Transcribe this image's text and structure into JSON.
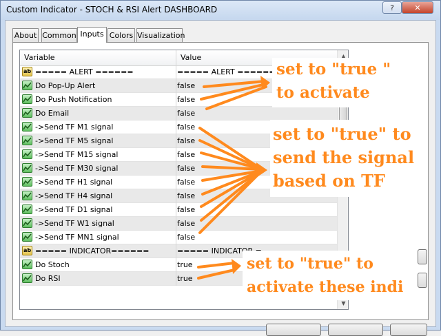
{
  "window": {
    "title": "Custom Indicator - STOCH & RSI Alert DASHBOARD",
    "help_label": "?",
    "close_label": "✕"
  },
  "tabs": [
    {
      "label": "About",
      "active": false
    },
    {
      "label": "Common",
      "active": false
    },
    {
      "label": "Inputs",
      "active": true
    },
    {
      "label": "Colors",
      "active": false
    },
    {
      "label": "Visualization",
      "active": false
    }
  ],
  "grid": {
    "columns": {
      "variable": "Variable",
      "value": "Value"
    },
    "rows": [
      {
        "icon": "ab-icon",
        "variable": "===== ALERT ======",
        "value": "===== ALERT ======"
      },
      {
        "icon": "chart-icon",
        "variable": "Do Pop-Up Alert",
        "value": "false"
      },
      {
        "icon": "chart-icon",
        "variable": "Do Push Notification",
        "value": "false"
      },
      {
        "icon": "chart-icon",
        "variable": "Do Email",
        "value": "false"
      },
      {
        "icon": "chart-icon",
        "variable": "->Send TF M1 signal",
        "value": "false"
      },
      {
        "icon": "chart-icon",
        "variable": "->Send TF M5 signal",
        "value": "false"
      },
      {
        "icon": "chart-icon",
        "variable": "->Send TF M15 signal",
        "value": "false"
      },
      {
        "icon": "chart-icon",
        "variable": "->Send TF M30 signal",
        "value": "false"
      },
      {
        "icon": "chart-icon",
        "variable": "->Send TF H1 signal",
        "value": "false"
      },
      {
        "icon": "chart-icon",
        "variable": "->Send TF H4 signal",
        "value": "false"
      },
      {
        "icon": "chart-icon",
        "variable": "->Send TF D1 signal",
        "value": "false"
      },
      {
        "icon": "chart-icon",
        "variable": "->Send TF W1 signal",
        "value": "false"
      },
      {
        "icon": "chart-icon",
        "variable": "->Send TF MN1 signal",
        "value": "false"
      },
      {
        "icon": "ab-icon",
        "variable": "===== INDICATOR======",
        "value": "===== INDICATOR ="
      },
      {
        "icon": "chart-icon",
        "variable": "Do Stoch",
        "value": "true"
      },
      {
        "icon": "chart-icon",
        "variable": "Do RSI",
        "value": "true"
      }
    ]
  },
  "annotations": {
    "alert_note": [
      "set to \"true \"",
      "to activate"
    ],
    "tf_note": [
      "set to \"true\" to",
      "send the signal",
      "based on TF"
    ],
    "indicator_note": [
      "set to \"true\" to",
      "activate these indi"
    ],
    "color": "#ff8a1e"
  },
  "colors": {
    "accent": "#ff8a1e",
    "row_alt": "#e9e9e9"
  }
}
